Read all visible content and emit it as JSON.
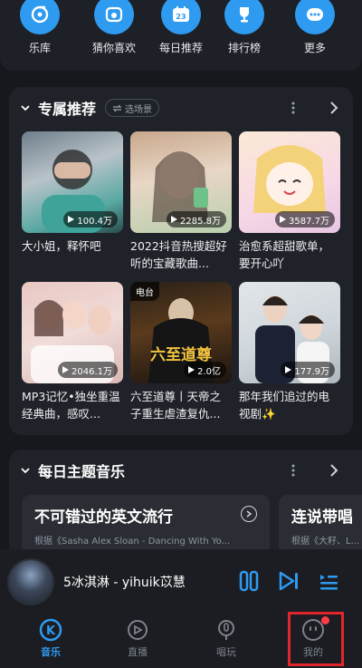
{
  "categories": [
    {
      "label": "乐库",
      "icon": "music-library-icon"
    },
    {
      "label": "猜你喜欢",
      "icon": "guess-like-icon"
    },
    {
      "label": "每日推荐",
      "icon": "calendar-icon",
      "badge": "23"
    },
    {
      "label": "排行榜",
      "icon": "trophy-icon"
    },
    {
      "label": "更多",
      "icon": "more-icon"
    }
  ],
  "exclusive": {
    "title": "专属推荐",
    "scene_label": "选场景",
    "cards": [
      {
        "title": "大小姐，释怀吧",
        "count": "100.4万"
      },
      {
        "title": "2022抖音热搜超好听的宝藏歌曲...",
        "count": "2285.8万"
      },
      {
        "title": "治愈系超甜歌单，要开心吖",
        "count": "3587.7万"
      },
      {
        "title": "MP3记忆•独坐重温经典曲，感叹...",
        "count": "2046.1万"
      },
      {
        "title": "六至道尊丨天帝之子重生虐渣复仇...",
        "count": "2.0亿",
        "tag": "电台",
        "cover_text": "六至道尊"
      },
      {
        "title": "那年我们追过的电视剧✨",
        "count": "177.9万"
      }
    ]
  },
  "daily_theme": {
    "title": "每日主题音乐",
    "cards": [
      {
        "title": "不可错过的英文流行",
        "subtitle": "根据《Sasha Alex Sloan - Dancing With Yo..."
      },
      {
        "title": "连说带唱",
        "subtitle": "根据《大籽、L..."
      }
    ]
  },
  "player": {
    "now_playing": "5冰淇淋 - yihuik苡慧"
  },
  "nav": [
    {
      "label": "音乐",
      "icon": "music-k-icon",
      "active": true
    },
    {
      "label": "直播",
      "icon": "live-icon",
      "active": false
    },
    {
      "label": "唱玩",
      "icon": "mic-icon",
      "active": false
    },
    {
      "label": "我的",
      "icon": "profile-icon",
      "active": false
    }
  ],
  "colors": {
    "accent": "#2e9bf0",
    "background": "#16181d",
    "card": "#1f2228",
    "highlight": "#e0262b"
  }
}
